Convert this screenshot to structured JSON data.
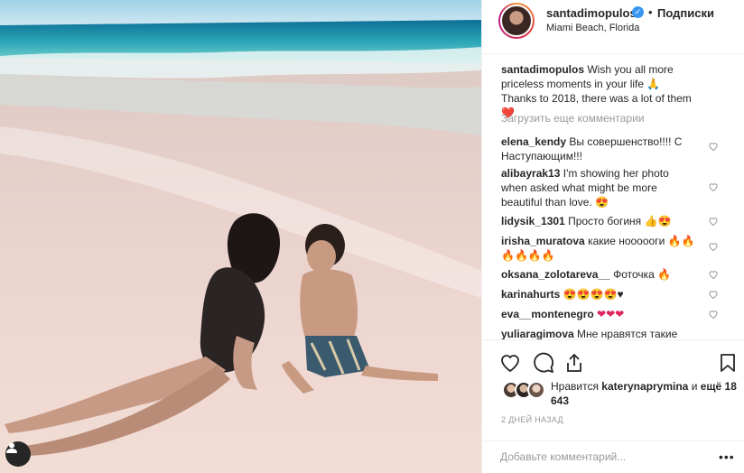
{
  "post": {
    "image_alt": "Woman in black swimsuit kissing a boy on a pink sand beach"
  },
  "header": {
    "username": "santadimopulos",
    "separator": "•",
    "follow_label": "Подписки",
    "location": "Miami Beach, Florida",
    "verified_icon": "verified-badge-icon"
  },
  "caption": {
    "username": "santadimopulos",
    "text": "Wish you all more priceless moments in your life 🙏 Thanks to 2018, there was a lot of them ❤️"
  },
  "load_more": "Загрузить еще комментарии",
  "comments": [
    {
      "username": "elena_kendy",
      "text": "Вы совершенство!!!! С Наступающим!!!"
    },
    {
      "username": "alibayrak13",
      "text": "I'm showing her photo when asked what might be more beautiful than love. 😍"
    },
    {
      "username": "lidysik_1301",
      "text": "Просто богиня 👍😍"
    },
    {
      "username": "irisha_muratova",
      "text": "какие ноооооги 🔥🔥🔥🔥🔥🔥"
    },
    {
      "username": "oksana_zolotareva__",
      "text": "Фоточка 🔥"
    },
    {
      "username": "karinahurts",
      "text": "😍😍😍😍♥"
    },
    {
      "username": "eva__montenegro",
      "text": "❤❤❤"
    },
    {
      "username": "yuliaragimova",
      "text": "Мне нравятся такие"
    }
  ],
  "likes": {
    "prefix": "Нравится",
    "liker": "katerynaprymina",
    "mid": "и",
    "more": "ещё 18 643"
  },
  "timestamp": "2 ДНЕЙ НАЗАД",
  "add_comment": {
    "placeholder": "Добавьте комментарий..."
  },
  "colors": {
    "link": "#262626",
    "muted": "#999999",
    "verified": "#3897f0",
    "border": "#efefef"
  }
}
